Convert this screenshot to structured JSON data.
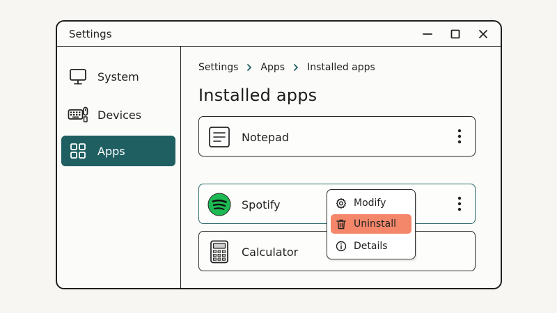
{
  "window": {
    "title": "Settings"
  },
  "sidebar": {
    "items": [
      {
        "label": "System",
        "icon": "monitor-icon",
        "active": false
      },
      {
        "label": "Devices",
        "icon": "keyboard-icon",
        "active": false
      },
      {
        "label": "Apps",
        "icon": "grid-icon",
        "active": true
      }
    ]
  },
  "breadcrumb": [
    "Settings",
    "Apps",
    "Installed apps"
  ],
  "main": {
    "title": "Installed apps",
    "apps": [
      {
        "name": "Notepad",
        "icon": "notepad-icon"
      },
      {
        "name": "Spotify",
        "icon": "spotify-icon",
        "selected": true
      },
      {
        "name": "Calculator",
        "icon": "calculator-icon"
      }
    ]
  },
  "context_menu": {
    "items": [
      {
        "label": "Modify",
        "icon": "gear-icon"
      },
      {
        "label": "Uninstall",
        "icon": "trash-icon",
        "highlighted": true
      },
      {
        "label": "Details",
        "icon": "info-icon"
      }
    ]
  },
  "colors": {
    "accent": "#1f5f62",
    "selected_border": "#2c6a6c",
    "menu_highlight": "#f4876a",
    "spotify_green": "#1db954"
  }
}
